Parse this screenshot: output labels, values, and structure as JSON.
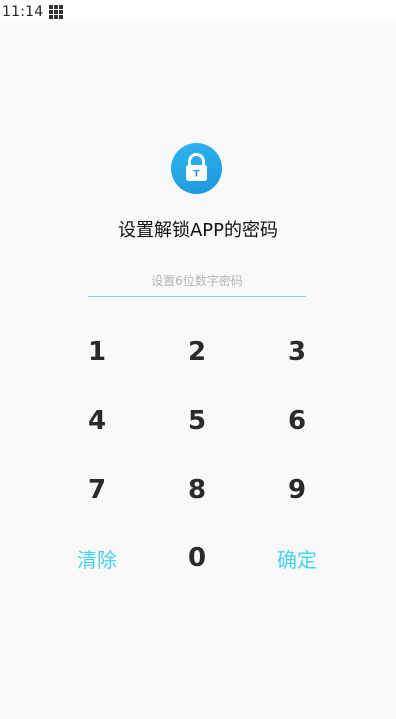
{
  "status_bar": {
    "time": "11:14"
  },
  "lock": {
    "icon_letter": "T"
  },
  "title": "设置解锁APP的密码",
  "pin_field": {
    "placeholder": "设置6位数字密码",
    "value": ""
  },
  "keypad": {
    "k1": "1",
    "k2": "2",
    "k3": "3",
    "k4": "4",
    "k5": "5",
    "k6": "6",
    "k7": "7",
    "k8": "8",
    "k9": "9",
    "clear": "清除",
    "k0": "0",
    "confirm": "确定"
  },
  "colors": {
    "accent": "#46d3ef",
    "lock_badge": "#1fa3e3",
    "underline": "#78dbef"
  }
}
